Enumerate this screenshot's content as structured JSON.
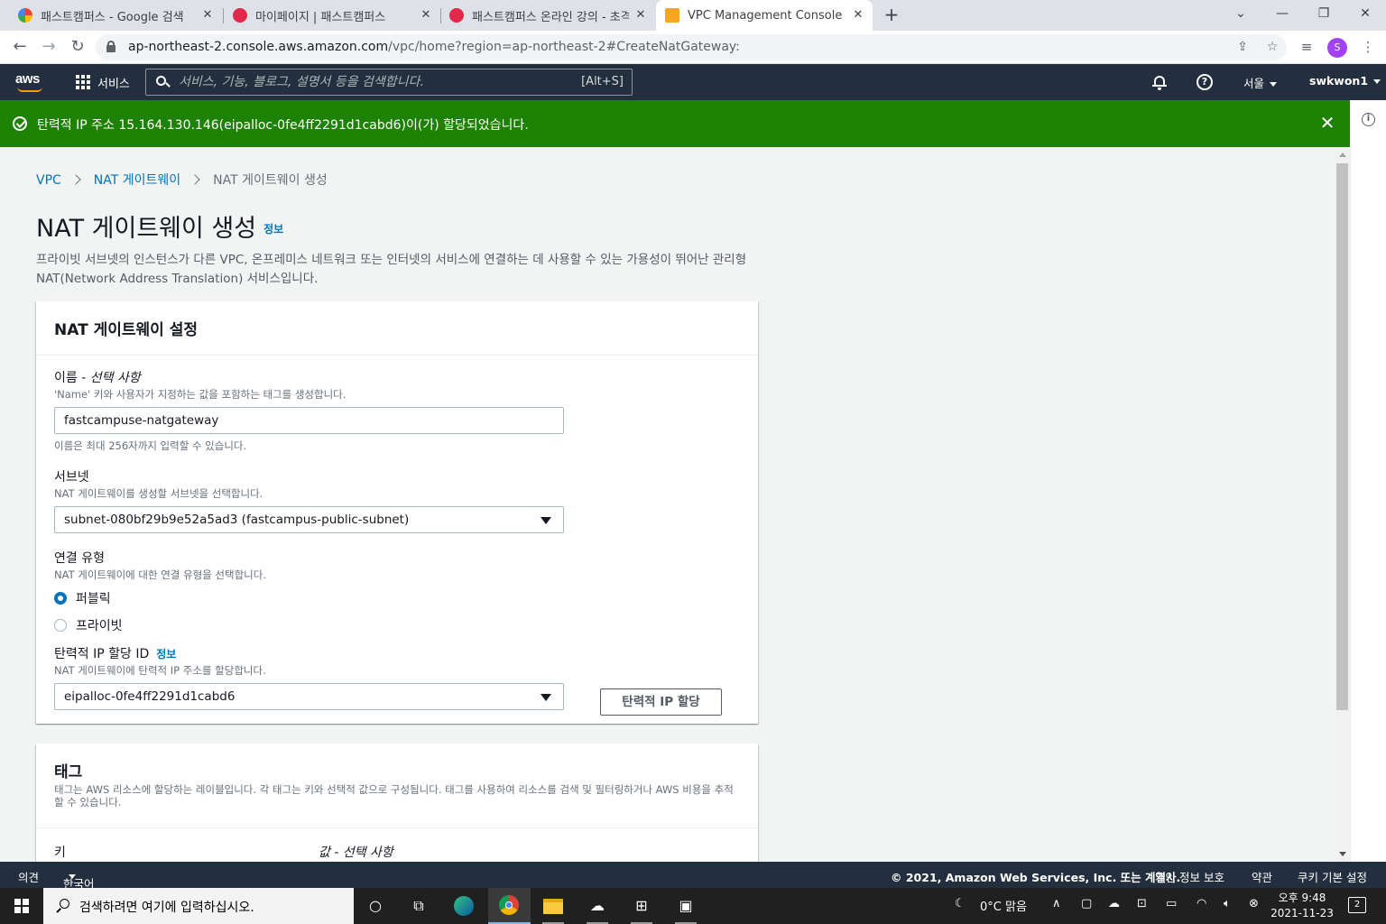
{
  "browser": {
    "tabs": [
      {
        "title": "패스트캠퍼스 - Google 검색",
        "favicon": "google-icon",
        "active": false
      },
      {
        "title": "마이페이지 | 패스트캠퍼스",
        "favicon": "fastcampus-icon",
        "active": false
      },
      {
        "title": "패스트캠퍼스 온라인 강의 - 초격차",
        "favicon": "fastcampus-icon",
        "active": false
      },
      {
        "title": "VPC Management Console",
        "favicon": "aws-box-icon",
        "active": true
      }
    ],
    "url_host": "ap-northeast-2.console.aws.amazon.com",
    "url_path": "/vpc/home?region=ap-northeast-2#CreateNatGateway:",
    "profile_initial": "S"
  },
  "aws_nav": {
    "logo": "aws",
    "services_label": "서비스",
    "search_placeholder": "서비스, 기능, 블로그, 설명서 등을 검색합니다.",
    "search_shortcut": "[Alt+S]",
    "region": "서울",
    "account": "swkwon1"
  },
  "flash": {
    "message": "탄력적 IP 주소 15.164.130.146(eipalloc-0fe4ff2291d1cabd6)이(가) 할당되었습니다.",
    "color": "#1d8102"
  },
  "breadcrumb": [
    {
      "label": "VPC",
      "link": true
    },
    {
      "label": "NAT 게이트웨이",
      "link": true
    },
    {
      "label": "NAT 게이트웨이 생성",
      "link": false
    }
  ],
  "page": {
    "title": "NAT 게이트웨이 생성",
    "info_link": "정보",
    "description": "프라이빗 서브넷의 인스턴스가 다른 VPC, 온프레미스 네트워크 또는 인터넷의 서비스에 연결하는 데 사용할 수 있는 가용성이 뛰어난 관리형 NAT(Network Address Translation) 서비스입니다."
  },
  "settings_panel": {
    "header": "NAT 게이트웨이 설정",
    "name_label": "이름 - ",
    "name_label_optional": "선택 사항",
    "name_desc": "'Name' 키와 사용자가 지정하는 값을 포함하는 태그를 생성합니다.",
    "name_value": "fastcampuse-natgateway",
    "name_hint": "이름은 최대 256자까지 입력할 수 있습니다.",
    "subnet_label": "서브넷",
    "subnet_desc": "NAT 게이트웨이를 생성할 서브넷을 선택합니다.",
    "subnet_value": "subnet-080bf29b9e52a5ad3 (fastcampus-public-subnet)",
    "conn_label": "연결 유형",
    "conn_desc": "NAT 게이트웨이에 대한 연결 유형을 선택합니다.",
    "conn_options": [
      "퍼블릭",
      "프라이빗"
    ],
    "conn_selected": "퍼블릭",
    "eip_label": "탄력적 IP 할당 ID",
    "eip_info": "정보",
    "eip_desc": "NAT 게이트웨이에 탄력적 IP 주소를 할당합니다.",
    "eip_value": "eipalloc-0fe4ff2291d1cabd6",
    "eip_button": "탄력적 IP 할당"
  },
  "tags_panel": {
    "header": "태그",
    "description": "태그는 AWS 리소스에 할당하는 레이블입니다. 각 태그는 키와 선택적 값으로 구성됩니다. 태그를 사용하여 리소스를 검색 및 필터링하거나 AWS 비용을 추적할 수 있습니다.",
    "key_label": "키",
    "value_label": "값 - 선택 사항"
  },
  "footer": {
    "feedback": "의견",
    "language": "한국어",
    "copyright": "© 2021, Amazon Web Services, Inc. 또는 계열사.",
    "privacy": "개인 정보 보호",
    "terms": "약관",
    "cookies": "쿠키 기본 설정"
  },
  "taskbar": {
    "search_placeholder": "검색하려면 여기에 입력하십시오.",
    "weather": "0°C  맑음",
    "time": "오후 9:48",
    "date": "2021-11-23",
    "notifications": "2"
  },
  "colors": {
    "aws_nav_bg": "#232f3e",
    "aws_orange": "#ff9900",
    "link_blue": "#0073bb",
    "success_green": "#1d8102"
  }
}
